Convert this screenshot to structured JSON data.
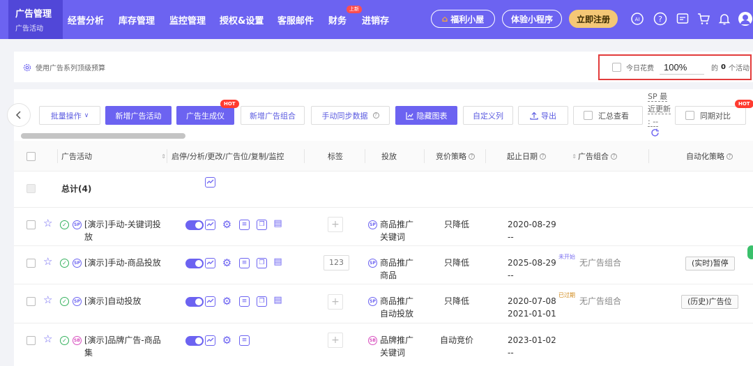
{
  "nav": {
    "active_label": "广告管理",
    "active_sub": "广告活动",
    "items": [
      "经营分析",
      "库存管理",
      "监控管理",
      "授权&设置",
      "客服邮件",
      "财务",
      "进销存"
    ],
    "new_badge": "上新",
    "pills": {
      "welfare": "福利小屋",
      "trial": "体验小程序",
      "register": "立即注册"
    },
    "ai_label": "AI"
  },
  "budget": {
    "link": "使用广告系列顶级预算",
    "today_label": "今日花费",
    "percent": "100%",
    "suffix_pre": "的",
    "count": "0",
    "suffix_post": "个活动"
  },
  "toolbar": {
    "batch": "批量操作",
    "new_campaign": "新增广告活动",
    "ad_generator": "广告生成仪",
    "hot": "HOT",
    "new_group": "新增广告组合",
    "sync": "手动同步数据",
    "hide_chart": "隐藏图表",
    "custom_column": "自定义列",
    "export": "导出",
    "summary_view": "汇总查看",
    "sp_note": "SP 最近更新 : --",
    "yoy": "同期对比"
  },
  "table": {
    "headers": {
      "campaign": "广告活动",
      "actions": "启停/分析/更改/广告位/复制/监控",
      "tag": "标签",
      "targeting": "投放",
      "bidding": "竞价策略",
      "dates": "起止日期",
      "group": "广告组合",
      "automation": "自动化策略"
    },
    "total_label": "总计(4)",
    "rows": [
      {
        "name": "[演示]手动-关键词投放",
        "tag": "",
        "target_l1": "商品推广",
        "target_l2": "关键词",
        "bid": "只降低",
        "start": "2020-08-29",
        "end": "--",
        "status": "",
        "group": "",
        "strategy": ""
      },
      {
        "name": "[演示]手动-商品投放",
        "tag": "123",
        "target_l1": "商品推广",
        "target_l2": "商品",
        "bid": "只降低",
        "start": "2025-08-29",
        "end": "--",
        "status": "未开始",
        "group": "无广告组合",
        "strategy": "(实时)暂停"
      },
      {
        "name": "[演示]自动投放",
        "tag": "",
        "target_l1": "商品推广",
        "target_l2": "自动投放",
        "bid": "只降低",
        "start": "2020-07-08",
        "end": "2021-01-01",
        "status": "已过期",
        "group": "无广告组合",
        "strategy": "(历史)广告位"
      },
      {
        "name": "[演示]品牌广告-商品集",
        "tag": "",
        "target_l1": "品牌推广",
        "target_l2": "关键词",
        "bid": "自动竞价",
        "start": "2023-01-02",
        "end": "--",
        "status": "",
        "group": "",
        "strategy": ""
      }
    ]
  },
  "colors": {
    "primary": "#6c63f1",
    "nav_active": "#5147d8",
    "register": "#f4c776",
    "alert": "#e23b3b"
  }
}
